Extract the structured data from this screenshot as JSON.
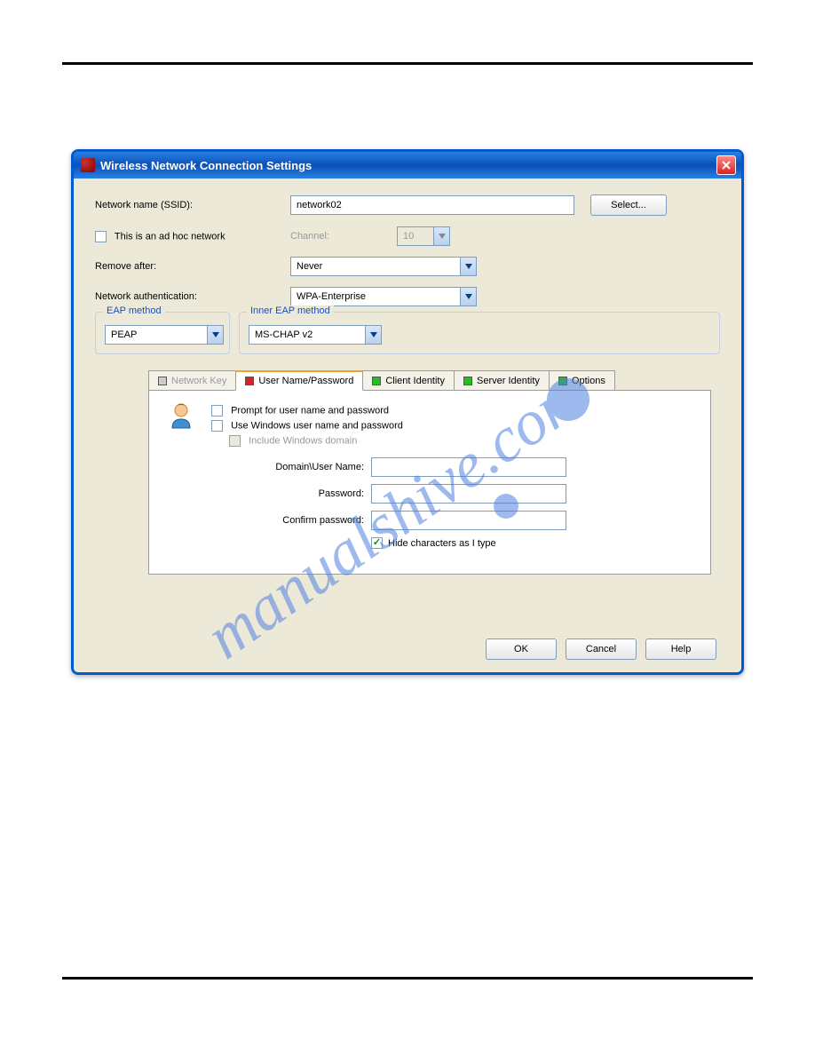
{
  "dialog": {
    "title": "Wireless Network Connection Settings",
    "labels": {
      "ssid": "Network name (SSID):",
      "adhoc": "This is an ad hoc network",
      "channel": "Channel:",
      "remove": "Remove after:",
      "auth": "Network authentication:"
    },
    "values": {
      "ssid": "network02",
      "channel": "10",
      "remove": "Never",
      "auth": "WPA-Enterprise"
    },
    "select_btn": "Select...",
    "eap": {
      "outer_legend": "EAP method",
      "outer_value": "PEAP",
      "inner_legend": "Inner EAP method",
      "inner_value": "MS-CHAP v2"
    },
    "tabs": [
      {
        "label": "Network Key",
        "color": "gray",
        "state": "disabled"
      },
      {
        "label": "User Name/Password",
        "color": "red",
        "state": "active"
      },
      {
        "label": "Client Identity",
        "color": "green",
        "state": "normal"
      },
      {
        "label": "Server Identity",
        "color": "green",
        "state": "normal"
      },
      {
        "label": "Options",
        "color": "green",
        "state": "normal"
      }
    ],
    "panel": {
      "prompt": "Prompt for user name and password",
      "usewin": "Use Windows user name and password",
      "includedom": "Include Windows domain",
      "domuser": "Domain\\User Name:",
      "password": "Password:",
      "confirm": "Confirm password:",
      "hide": "Hide characters as I type"
    },
    "buttons": {
      "ok": "OK",
      "cancel": "Cancel",
      "help": "Help"
    }
  },
  "watermark": "manualshive.com"
}
